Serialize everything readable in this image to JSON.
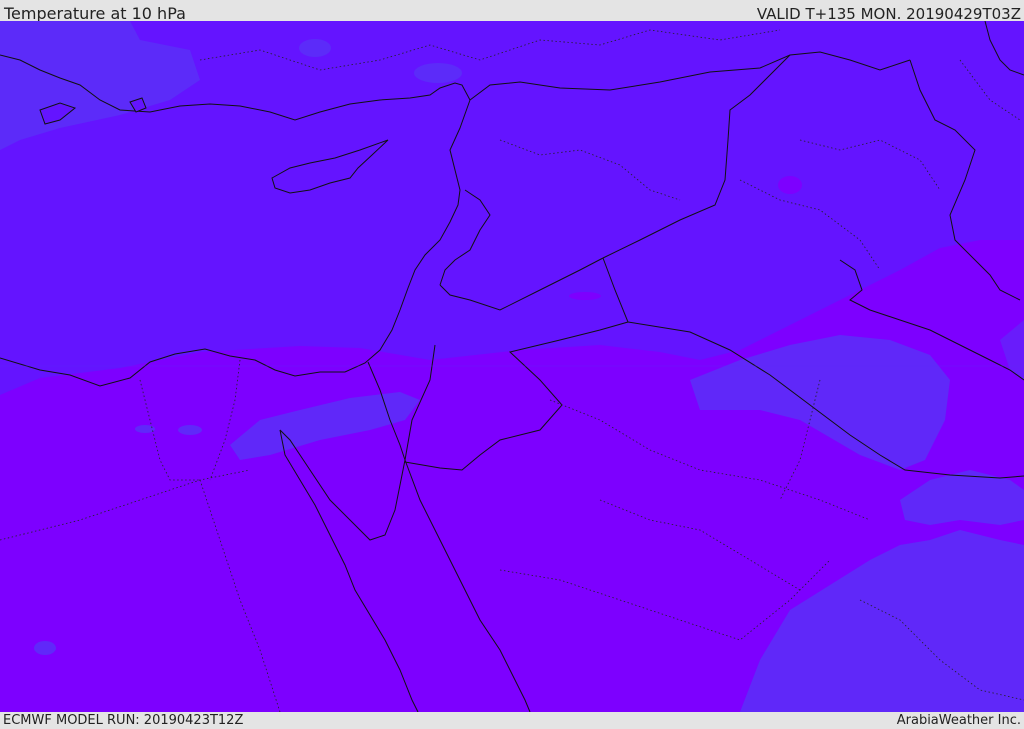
{
  "header": {
    "title": "Temperature at 10 hPa",
    "valid": "VALID T+135 MON. 20190429T03Z"
  },
  "footer": {
    "model_run": "ECMWF MODEL RUN: 20190423T12Z",
    "credit": "ArabiaWeather Inc."
  },
  "map": {
    "colors": {
      "base_fill": "#6414ff",
      "warm_fill": "#7d00ff",
      "cool_fill": "#5b2ff8",
      "border_line": "#111111",
      "admin_line": "#222222"
    }
  }
}
